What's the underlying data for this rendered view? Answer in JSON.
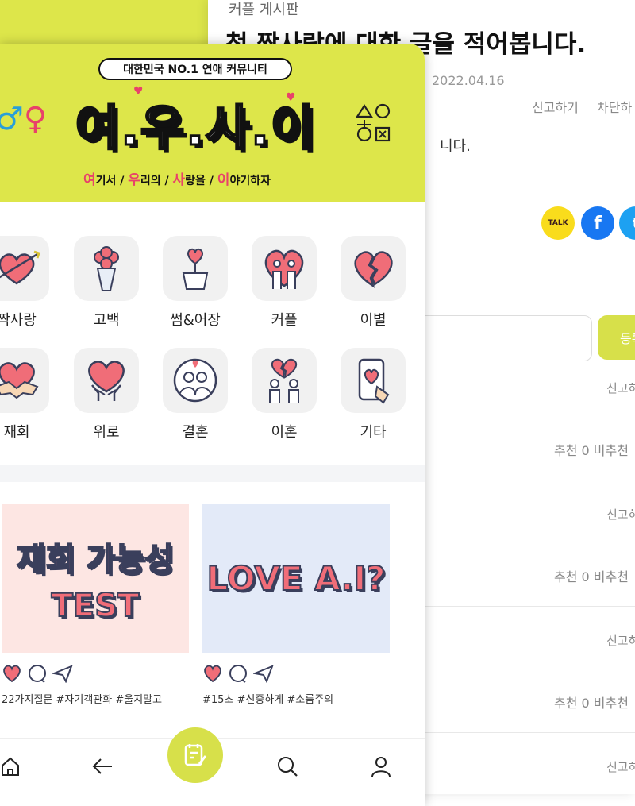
{
  "post": {
    "board": "커플 게시판",
    "title": "첫 짝사랑에 대한 글을 적어봅니다.",
    "date": "2022.04.16",
    "report": "신고하기",
    "block": "차단하",
    "body": "니다.",
    "share": {
      "kakao_label": "TALK",
      "facebook_label": "f",
      "twitter_label": "t"
    }
  },
  "comment_form": {
    "placeholder": "",
    "submit_label": "등록"
  },
  "comments": [
    {
      "report": "신고하",
      "vote": "추천 0  비추천"
    },
    {
      "report": "신고하",
      "vote": "추천 0  비추천"
    },
    {
      "report": "신고하",
      "vote": "추천 0  비추천"
    },
    {
      "report": "신고하",
      "vote": ""
    }
  ],
  "app": {
    "badge": "대한민국 NO.1 연애 커뮤니티",
    "logo": "여.우.사.이",
    "tagline": {
      "a": "여",
      "a_rest": "기서 / ",
      "b": "우",
      "b_rest": "리의 / ",
      "c": "사",
      "c_rest": "랑을 / ",
      "d": "이",
      "d_rest": "야기하자"
    },
    "gender_male": "♂",
    "gender_female": "♀",
    "categories": [
      {
        "label": "짝사랑",
        "icon": "heart-arrow-icon"
      },
      {
        "label": "고백",
        "icon": "bouquet-icon"
      },
      {
        "label": "썸&어장",
        "icon": "heart-plant-icon"
      },
      {
        "label": "커플",
        "icon": "couple-heart-icon"
      },
      {
        "label": "이별",
        "icon": "broken-heart-icon"
      },
      {
        "label": "재회",
        "icon": "handshake-heart-icon"
      },
      {
        "label": "위로",
        "icon": "hands-heart-icon"
      },
      {
        "label": "결혼",
        "icon": "wedding-couple-icon"
      },
      {
        "label": "이혼",
        "icon": "divorce-icon"
      },
      {
        "label": "기타",
        "icon": "phone-heart-icon"
      }
    ],
    "cards": [
      {
        "line1": "재회 가능성",
        "line2": "TEST",
        "tags": "22가지질문  #자기객관화  #울지말고",
        "bg": "#fde6e3"
      },
      {
        "line1": "LOVE A.I?",
        "line2": "",
        "tags": "#15초  #신중하게  #소름주의",
        "bg": "#e3eaf8"
      }
    ]
  },
  "colors": {
    "brand": "#dde64a",
    "accent": "#e8426a",
    "fab": "#d7e04a"
  }
}
